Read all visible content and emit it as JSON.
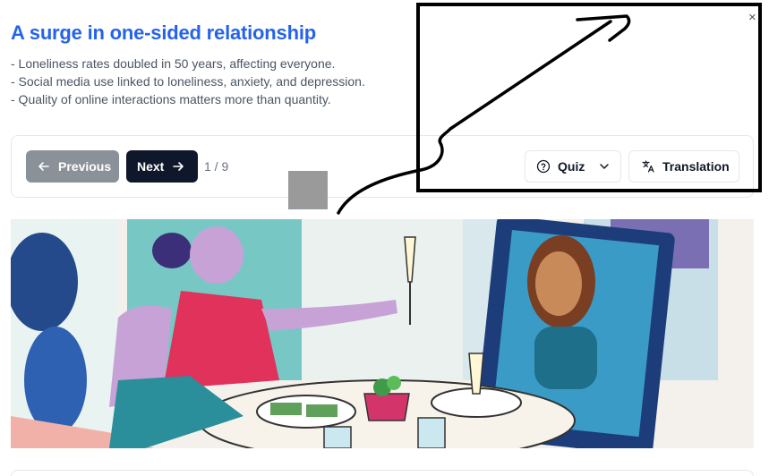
{
  "slide": {
    "title": "A surge in one-sided relationship",
    "bullets": [
      "- Loneliness rates doubled in 50 years, affecting everyone.",
      "- Social media use linked to loneliness, anxiety, and depression.",
      "- Quality of online interactions matters more than quantity."
    ]
  },
  "controls": {
    "previous_label": "Previous",
    "next_label": "Next",
    "page_counter": "1 / 9",
    "quiz_label": "Quiz",
    "translation_label": "Translation",
    "close_glyph": "×"
  },
  "icons": {
    "previous": "arrow-left-icon",
    "next": "arrow-right-icon",
    "quiz": "help-circle-icon",
    "quiz_caret": "chevron-down-icon",
    "translation": "translate-icon",
    "close": "close-icon"
  },
  "colors": {
    "title": "#2563eb",
    "previous_bg": "#8b9198",
    "next_bg": "#0f172a",
    "annotation": "#000000"
  },
  "illustration": {
    "alt": "Woman toasting a smartphone showing a friend at a dinner table"
  }
}
